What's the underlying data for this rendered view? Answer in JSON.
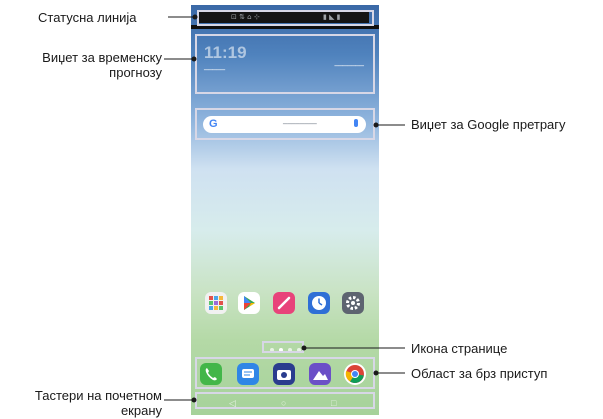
{
  "labels": {
    "status_bar": "Статусна линија",
    "weather_widget_line1": "Виџет за временску",
    "weather_widget_line2": "прогнозу",
    "google_widget": "Виџет за Google претрагу",
    "page_icon": "Икона странице",
    "quick_access": "Област за брз приступ",
    "home_buttons_line1": "Тастери на почетном",
    "home_buttons_line2": "екрану"
  },
  "phone": {
    "weather_time": "11:19",
    "google_logo": "G",
    "apps": [
      "app-folder-icon",
      "play-store-icon",
      "notes-icon",
      "clock-icon",
      "settings-icon"
    ],
    "dock": [
      "phone-icon",
      "messages-icon",
      "camera-icon",
      "gallery-icon",
      "chrome-icon"
    ]
  },
  "colors": {
    "highlight": "#d7d7e6",
    "leader_line": "#1a1a1a",
    "dot": "#1a1a1a"
  }
}
